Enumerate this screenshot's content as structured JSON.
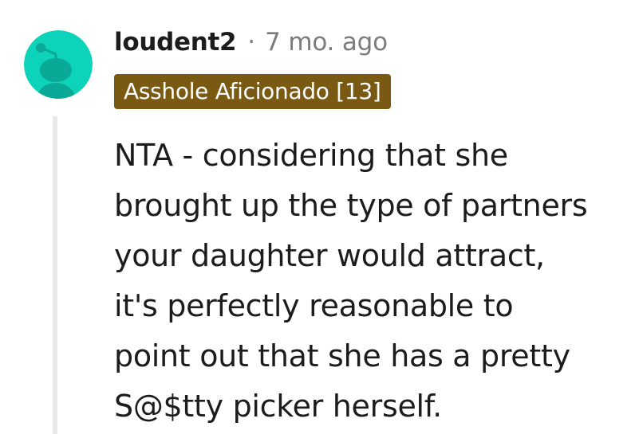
{
  "comment": {
    "author": "loudent2",
    "separator": "·",
    "timestamp": "7 mo. ago",
    "flair": {
      "text": "Asshole Aficionado [13]",
      "background": "#7a5a13"
    },
    "avatar": {
      "icon": "reddit-snoo-icon",
      "background": "#0dd3bb",
      "figure_color": "#0aa897"
    },
    "body_lines": [
      "NTA - considering that she",
      "brought up the type of partners",
      "your daughter would attract,",
      "it's perfectly reasonable to",
      "point out that she has a pretty",
      "S@$tty picker herself."
    ]
  },
  "colors": {
    "text": "#1c1c1c",
    "meta": "#7c7c7c",
    "thread_line": "#e9e9e9"
  }
}
